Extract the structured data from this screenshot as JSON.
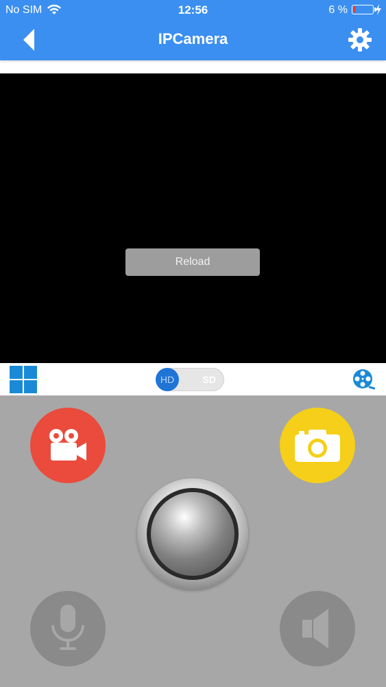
{
  "status_bar": {
    "carrier": "No SIM",
    "time": "12:56",
    "battery_percent": "6 %",
    "icons": [
      "wifi-icon",
      "battery-icon",
      "charging-bolt-icon"
    ]
  },
  "nav": {
    "title": "IPCamera",
    "back_icon": "chevron-left-icon",
    "settings_icon": "gear-icon"
  },
  "video": {
    "reload_label": "Reload"
  },
  "toolbar": {
    "grid_icon": "grid-layout-icon",
    "quality": {
      "hd_label": "HD",
      "sd_label": "SD",
      "selected": "HD"
    },
    "playback_icon": "film-reel-icon"
  },
  "controls": {
    "record_icon": "video-camera-icon",
    "snapshot_icon": "camera-icon",
    "joystick": "ptz-joystick",
    "mic_icon": "microphone-icon",
    "speaker_icon": "speaker-icon"
  },
  "colors": {
    "primary": "#3b8ff0",
    "record": "#ea4b3c",
    "snapshot": "#f5cf19",
    "panel": "#a7a7a7",
    "disabled_button": "#8a8a8a"
  }
}
